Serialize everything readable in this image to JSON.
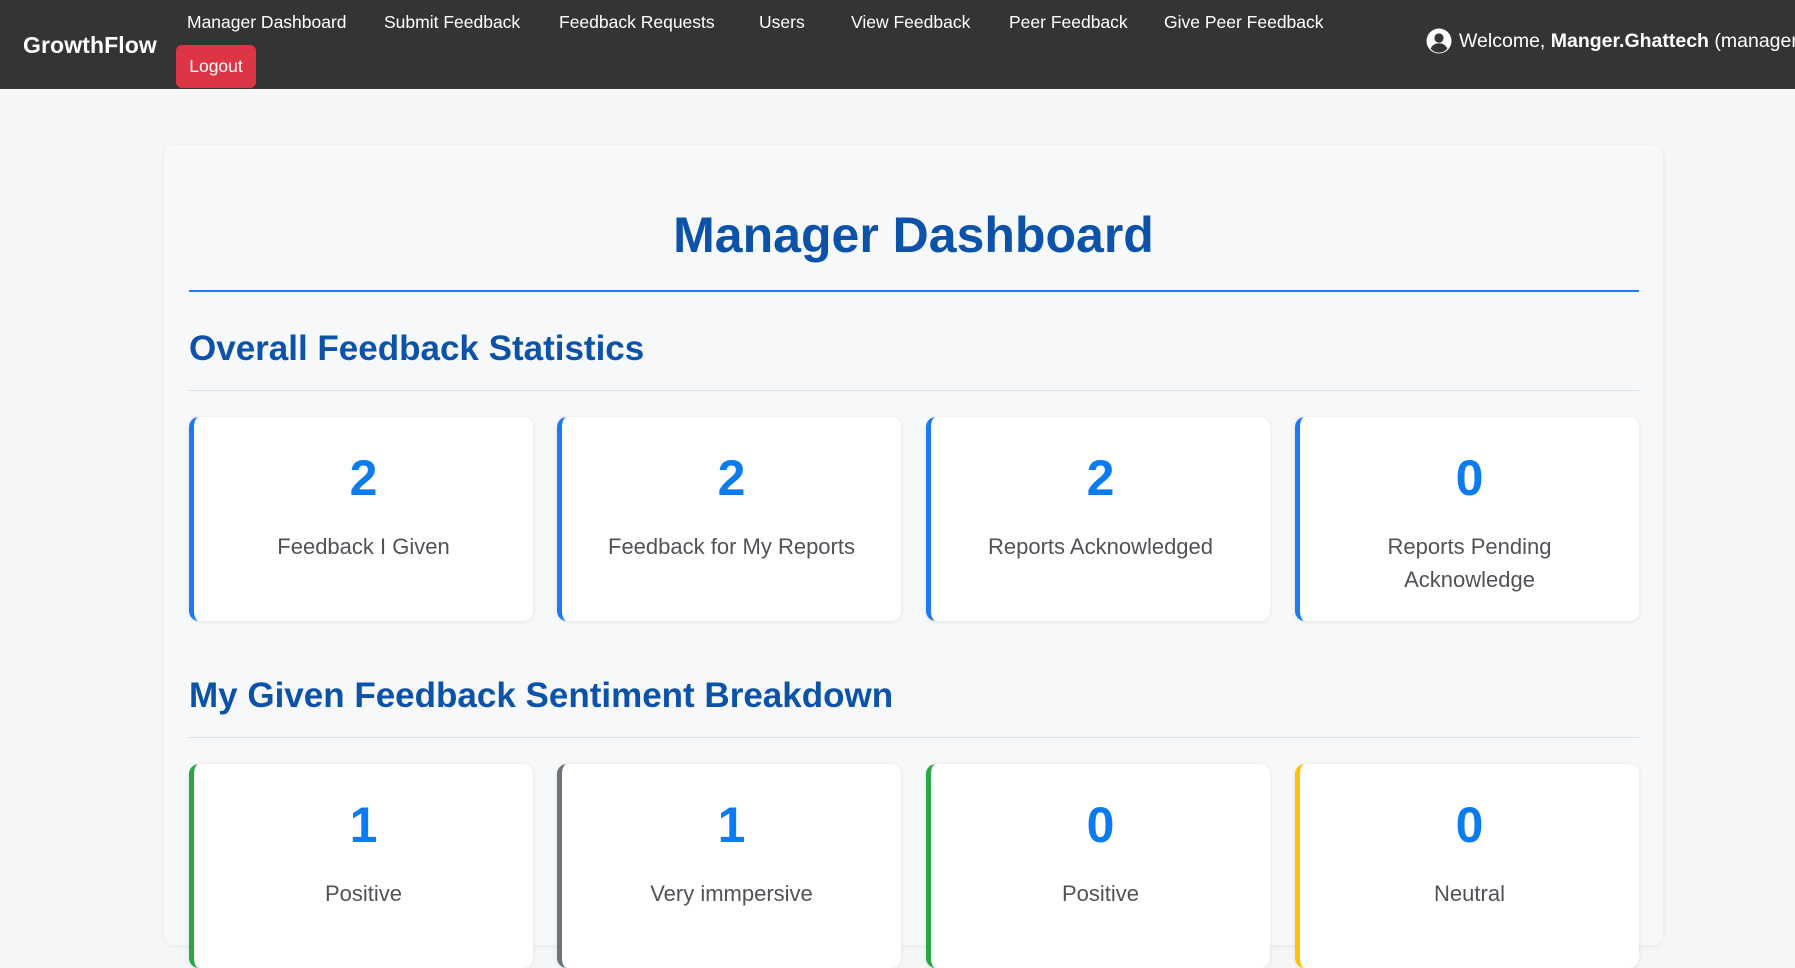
{
  "navbar": {
    "brand": "GrowthFlow",
    "links": [
      "Manager Dashboard",
      "Submit Feedback",
      "Feedback Requests",
      "Users",
      "View Feedback",
      "Peer Feedback",
      "Give Peer Feedback"
    ],
    "logout_label": "Logout",
    "user_icon": "user-circle-icon",
    "welcome_prefix": "Welcome,",
    "username": "Manger.Ghattech",
    "role_suffix": "(manager"
  },
  "page": {
    "title": "Manager Dashboard"
  },
  "overall_stats": {
    "title": "Overall Feedback Statistics",
    "cards": [
      {
        "value": "2",
        "label": "Feedback I Given"
      },
      {
        "value": "2",
        "label": "Feedback for My Reports"
      },
      {
        "value": "2",
        "label": "Reports Acknowledged"
      },
      {
        "value": "0",
        "label": "Reports Pending Acknowledge"
      }
    ]
  },
  "sentiment": {
    "title": "My Given Feedback Sentiment Breakdown",
    "cards": [
      {
        "value": "1",
        "label": "Positive",
        "accent": "#28a745"
      },
      {
        "value": "1",
        "label": "Very immpersive",
        "accent": "#6c757d"
      },
      {
        "value": "0",
        "label": "Positive",
        "accent": "#28a745"
      },
      {
        "value": "0",
        "label": "Neutral",
        "accent": "#ffc107"
      }
    ]
  },
  "colors": {
    "navbar_bg": "#343434",
    "logout_bg": "#dc3545",
    "heading": "#0b52a8",
    "stat_value": "#0d7bf0",
    "card_accent": "#1a7cf0"
  }
}
